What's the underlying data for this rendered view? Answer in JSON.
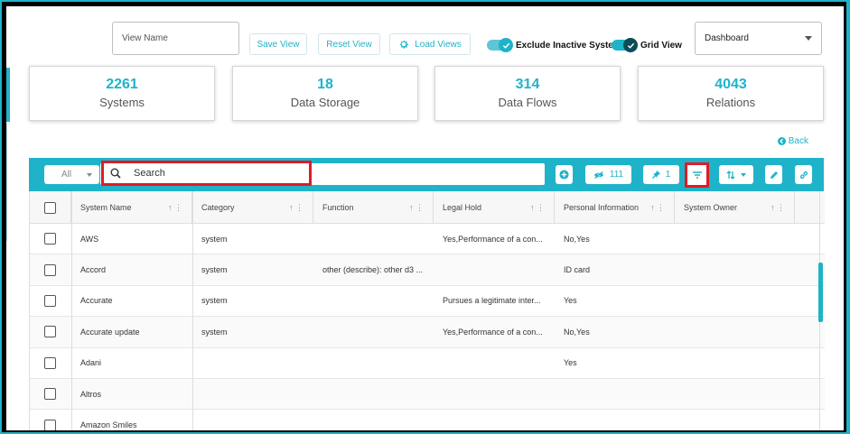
{
  "top": {
    "view_name_placeholder": "View Name",
    "save_view": "Save View",
    "reset_view": "Reset View",
    "load_views": "Load Views",
    "exclude_inactive": "Exclude Inactive Systems",
    "grid_view": "Grid View",
    "dashboard": "Dashboard"
  },
  "stats": [
    {
      "value": "2261",
      "label": "Systems"
    },
    {
      "value": "18",
      "label": "Data Storage"
    },
    {
      "value": "314",
      "label": "Data Flows"
    },
    {
      "value": "4043",
      "label": "Relations"
    }
  ],
  "back": "Back",
  "toolbar": {
    "all_label": "All",
    "search_placeholder": "Search",
    "hidden_count": "111",
    "pinned_count": "1"
  },
  "table": {
    "columns": [
      "System Name",
      "Category",
      "Function",
      "Legal Hold",
      "Personal Information",
      "System Owner"
    ],
    "rows": [
      {
        "name": "AWS",
        "category": "system",
        "function": "",
        "legal_hold": "Yes,Performance of a con...",
        "personal_info": "No,Yes",
        "owner": ""
      },
      {
        "name": "Accord",
        "category": "system",
        "function": "other (describe): other d3 ...",
        "legal_hold": "",
        "personal_info": "ID card",
        "owner": ""
      },
      {
        "name": "Accurate",
        "category": "system",
        "function": "",
        "legal_hold": "Pursues a legitimate inter...",
        "personal_info": "Yes",
        "owner": ""
      },
      {
        "name": "Accurate update",
        "category": "system",
        "function": "",
        "legal_hold": "Yes,Performance of a con...",
        "personal_info": "No,Yes",
        "owner": ""
      },
      {
        "name": "Adani",
        "category": "",
        "function": "",
        "legal_hold": "",
        "personal_info": "Yes",
        "owner": ""
      },
      {
        "name": "Altros",
        "category": "",
        "function": "",
        "legal_hold": "",
        "personal_info": "",
        "owner": ""
      },
      {
        "name": "Amazon Smiles",
        "category": "",
        "function": "",
        "legal_hold": "",
        "personal_info": "",
        "owner": ""
      }
    ]
  },
  "colors": {
    "accent": "#1fb3c9",
    "highlight": "#e01b24",
    "toggle_dark": "#0b4c57"
  }
}
